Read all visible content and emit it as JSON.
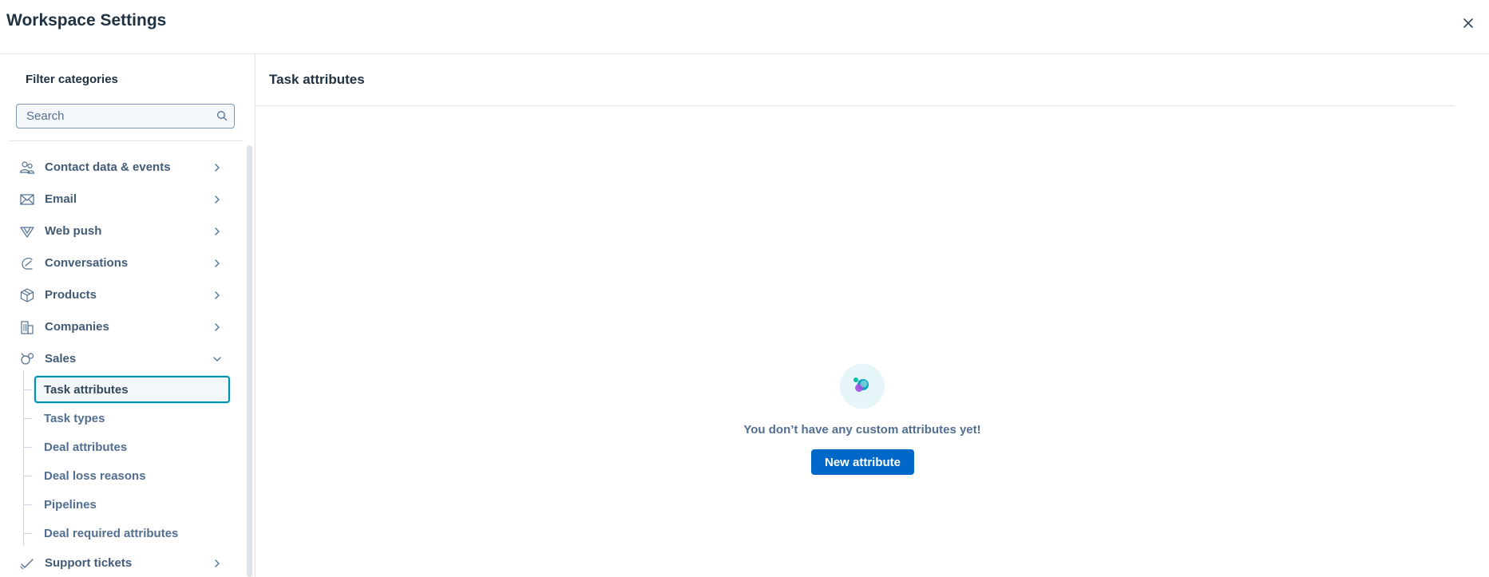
{
  "header": {
    "title": "Workspace Settings",
    "close_icon": "close-icon"
  },
  "sidebar": {
    "filter_heading": "Filter categories",
    "search": {
      "placeholder": "Search",
      "value": "",
      "icon": "search-icon"
    },
    "items": [
      {
        "label": "Contact data & events",
        "icon": "contacts-icon",
        "expanded": false
      },
      {
        "label": "Email",
        "icon": "email-icon",
        "expanded": false
      },
      {
        "label": "Web push",
        "icon": "web-push-icon",
        "expanded": false
      },
      {
        "label": "Conversations",
        "icon": "conversations-icon",
        "expanded": false
      },
      {
        "label": "Products",
        "icon": "products-icon",
        "expanded": false
      },
      {
        "label": "Companies",
        "icon": "companies-icon",
        "expanded": false
      },
      {
        "label": "Sales",
        "icon": "sales-icon",
        "expanded": true
      },
      {
        "label": "Support tickets",
        "icon": "support-tickets-icon",
        "expanded": false
      }
    ],
    "sales_subitems": [
      {
        "label": "Task attributes",
        "active": true
      },
      {
        "label": "Task types",
        "active": false
      },
      {
        "label": "Deal attributes",
        "active": false
      },
      {
        "label": "Deal loss reasons",
        "active": false
      },
      {
        "label": "Pipelines",
        "active": false
      },
      {
        "label": "Deal required attributes",
        "active": false
      }
    ]
  },
  "main": {
    "section_title": "Task attributes",
    "empty_state": {
      "message": "You don’t have any custom attributes yet!",
      "button_label": "New attribute",
      "illustration_icon": "attributes-illustration-icon"
    }
  },
  "colors": {
    "primary_button": "#0068c9",
    "active_border": "#0091ae",
    "heading_text": "#213343",
    "nav_text": "#425b76",
    "divider": "#dfe3eb"
  }
}
